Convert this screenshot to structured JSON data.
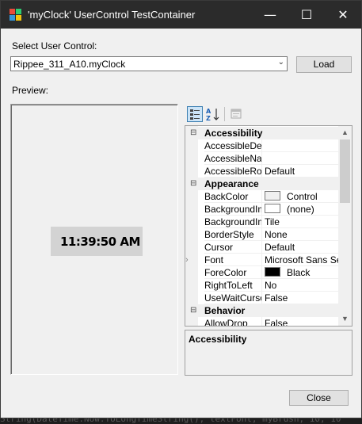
{
  "background_code": {
    "bottom_line": "String(DateTime.Now.ToLongTimeString(), textFont, myBrush, 10, 10"
  },
  "window": {
    "title": "'myClock' UserControl TestContainer",
    "minimize_glyph": "—",
    "maximize_glyph": "☐",
    "close_glyph": "✕"
  },
  "select_label": "Select User Control:",
  "combo": {
    "value": "Rippee_311_A10.myClock",
    "arrow": "⌄"
  },
  "load_button": "Load",
  "preview_label": "Preview:",
  "clock_text": "11:39:50 AM",
  "property_grid": {
    "toolbar": {
      "categorized_icon": "categorized-icon",
      "alphabetical_icon": "alphabetical-icon",
      "property_pages_icon": "property-pages-icon"
    },
    "rows": [
      {
        "type": "category",
        "name": "Accessibility",
        "expander": "⊟"
      },
      {
        "type": "prop",
        "name": "AccessibleDescription",
        "value": ""
      },
      {
        "type": "prop",
        "name": "AccessibleName",
        "value": ""
      },
      {
        "type": "prop",
        "name": "AccessibleRole",
        "value": "Default"
      },
      {
        "type": "category",
        "name": "Appearance",
        "expander": "⊟"
      },
      {
        "type": "prop",
        "name": "BackColor",
        "value": "Control",
        "swatch": "#f0f0f0"
      },
      {
        "type": "prop",
        "name": "BackgroundImage",
        "value": "(none)",
        "swatch": "#ffffff"
      },
      {
        "type": "prop",
        "name": "BackgroundImageLayout",
        "value": "Tile"
      },
      {
        "type": "prop",
        "name": "BorderStyle",
        "value": "None"
      },
      {
        "type": "prop",
        "name": "Cursor",
        "value": "Default"
      },
      {
        "type": "prop",
        "name": "Font",
        "value": "Microsoft Sans Serif",
        "expandable": true
      },
      {
        "type": "prop",
        "name": "ForeColor",
        "value": "Black",
        "swatch": "#000000"
      },
      {
        "type": "prop",
        "name": "RightToLeft",
        "value": "No"
      },
      {
        "type": "prop",
        "name": "UseWaitCursor",
        "value": "False"
      },
      {
        "type": "category",
        "name": "Behavior",
        "expander": "⊟"
      },
      {
        "type": "prop",
        "name": "AllowDrop",
        "value": "False"
      }
    ],
    "scroll_up": "▲",
    "scroll_down": "▼"
  },
  "description": {
    "title": "Accessibility"
  },
  "close_button": "Close"
}
